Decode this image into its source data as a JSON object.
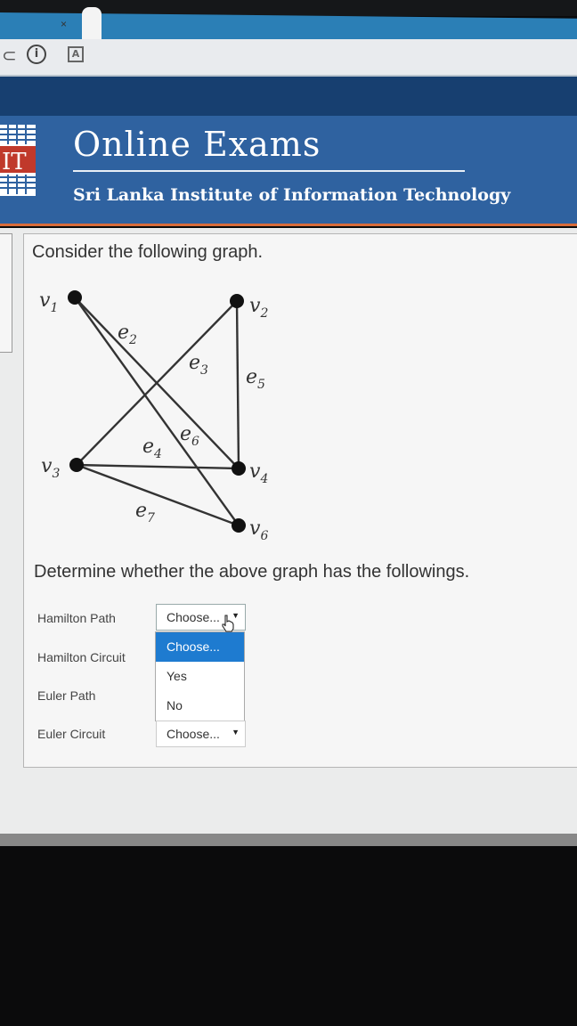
{
  "browser": {
    "tab_close": "×",
    "info_glyph": "i",
    "a_glyph": "A"
  },
  "header": {
    "logo_text": "IT",
    "title": "Online Exams",
    "subtitle": "Sri Lanka Institute of Information Technology"
  },
  "question": {
    "prompt": "Consider the following graph.",
    "followup": "Determine whether the above graph has the followings."
  },
  "graph": {
    "vertices": {
      "v1": "v",
      "v1_sub": "1",
      "v2": "v",
      "v2_sub": "2",
      "v3": "v",
      "v3_sub": "3",
      "v4": "v",
      "v4_sub": "4",
      "v6": "v",
      "v6_sub": "6"
    },
    "edges": {
      "e2": "e",
      "e2_sub": "2",
      "e3": "e",
      "e3_sub": "3",
      "e4": "e",
      "e4_sub": "4",
      "e5": "e",
      "e5_sub": "5",
      "e6": "e",
      "e6_sub": "6",
      "e7": "e",
      "e7_sub": "7"
    }
  },
  "answers": {
    "rows": [
      {
        "label": "Hamilton Path",
        "value": "Choose...",
        "open": true
      },
      {
        "label": "Hamilton Circuit",
        "value": ""
      },
      {
        "label": "Euler Path",
        "value": ""
      },
      {
        "label": "Euler Circuit",
        "value": "Choose..."
      }
    ],
    "options": [
      "Choose...",
      "Yes",
      "No"
    ],
    "highlighted_option": "Choose..."
  },
  "colors": {
    "tab_bar": "#2b7fb6",
    "header": "#2f62a0",
    "nav_band": "#173f70",
    "accent_line": "#d86b3a",
    "option_highlight": "#1e7bd0"
  },
  "icons": [
    "reload-icon",
    "info-icon",
    "a-icon",
    "close-icon",
    "hand-cursor-icon",
    "dropdown-arrow-icon"
  ]
}
